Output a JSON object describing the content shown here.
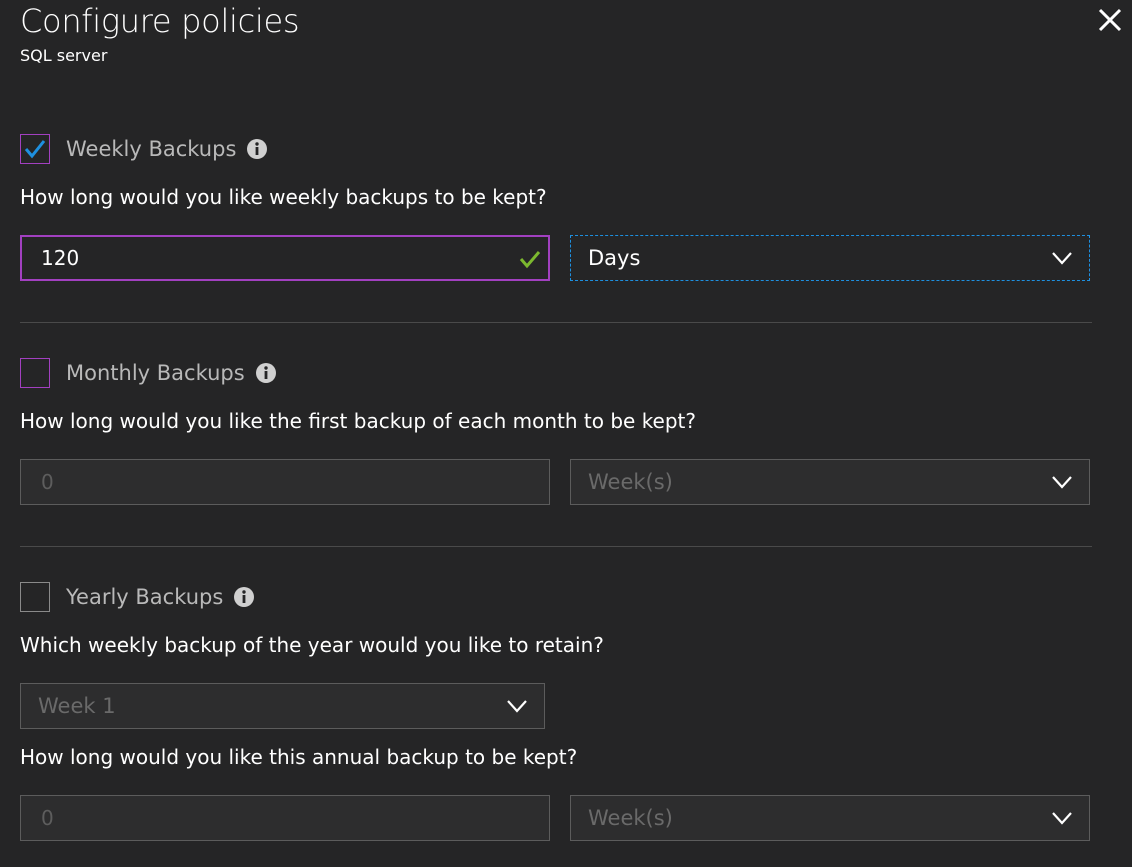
{
  "header": {
    "title": "Configure policies",
    "subtitle": "SQL server",
    "close_icon": "close-icon"
  },
  "weekly": {
    "label": "Weekly Backups",
    "checked": true,
    "question": "How long would you like weekly backups to be kept?",
    "value": "120",
    "unit": "Days"
  },
  "monthly": {
    "label": "Monthly Backups",
    "checked": false,
    "question": "How long would you like the first backup of each month to be kept?",
    "value": "0",
    "unit": "Week(s)"
  },
  "yearly": {
    "label": "Yearly Backups",
    "checked": false,
    "week_question": "Which weekly backup of the year would you like to retain?",
    "week": "Week 1",
    "question": "How long would you like this annual backup to be kept?",
    "value": "0",
    "unit": "Week(s)"
  },
  "colors": {
    "background": "#252526",
    "accent_purple": "#a240c0",
    "focus_blue": "#1e90e0",
    "check_blue": "#1e90e0",
    "valid_green": "#7cb82f"
  }
}
